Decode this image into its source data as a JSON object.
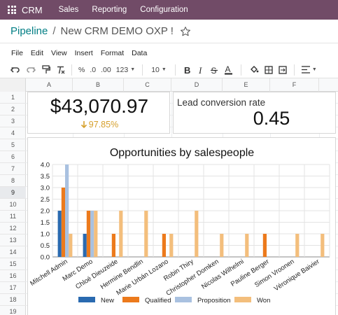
{
  "navbar": {
    "brand": "CRM",
    "menus": [
      "Sales",
      "Reporting",
      "Configuration"
    ],
    "color": "#714b67"
  },
  "breadcrumb": {
    "root": "Pipeline",
    "separator": "/",
    "current": "New CRM DEMO OXP !"
  },
  "menubar": [
    "File",
    "Edit",
    "View",
    "Insert",
    "Format",
    "Data"
  ],
  "toolbar": {
    "percent": "%",
    "decimal_less": ".0",
    "decimal_more": ".00",
    "number_format": "123",
    "font_size": "10"
  },
  "sheet": {
    "columns": [
      "A",
      "B",
      "C",
      "D",
      "E",
      "F"
    ],
    "rows": [
      "1",
      "2",
      "3",
      "4",
      "5",
      "6",
      "7",
      "8",
      "9",
      "10",
      "11",
      "12",
      "13",
      "14",
      "15",
      "16",
      "17",
      "18",
      "19"
    ],
    "active_row": "9"
  },
  "scorecards": {
    "revenue": {
      "value": "$43,070.97",
      "delta": "97.85%",
      "delta_color": "#d6a02c"
    },
    "conversion": {
      "title": "Lead conversion rate",
      "value": "0.45"
    }
  },
  "chart_data": {
    "type": "bar",
    "title": "Opportunities by salespeople",
    "xlabel": "",
    "ylabel": "",
    "ylim": [
      0,
      4
    ],
    "yticks": [
      "0.0",
      "0.5",
      "1.0",
      "1.5",
      "2.0",
      "2.5",
      "3.0",
      "3.5",
      "4.0"
    ],
    "categories": [
      "Mitchell Admin",
      "Marc Demo",
      "Chloé Dieuzeide",
      "Hermine Bendlin",
      "Marie Urbán Lozano",
      "Robin Thiry",
      "Christopher Domken",
      "Nicolas Wilhelmi",
      "Pauline Berger",
      "Simon Vroonen",
      "Véronique Baivier"
    ],
    "series": [
      {
        "name": "New",
        "color": "#2a6ab0",
        "values": [
          2,
          1,
          0,
          0,
          0,
          0,
          0,
          0,
          0,
          0,
          0
        ]
      },
      {
        "name": "Qualified",
        "color": "#ec7a1c",
        "values": [
          3,
          2,
          1,
          0,
          1,
          0,
          0,
          0,
          1,
          0,
          0
        ]
      },
      {
        "name": "Proposition",
        "color": "#a9c1e0",
        "values": [
          4,
          2,
          0,
          0,
          0,
          0,
          0,
          0,
          0,
          0,
          0
        ]
      },
      {
        "name": "Won",
        "color": "#f3be7c",
        "values": [
          1,
          2,
          2,
          2,
          1,
          2,
          1,
          1,
          0,
          1,
          1
        ]
      }
    ],
    "legend": "bottom",
    "grid": true
  }
}
